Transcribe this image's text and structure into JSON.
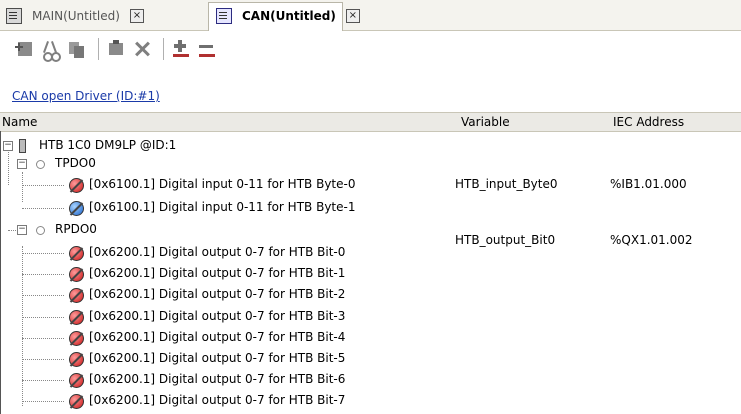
{
  "tabs": [
    {
      "label": "MAIN(Untitled)",
      "active": false,
      "icon": "program-icon",
      "close": "×"
    },
    {
      "label": "CAN(Untitled)",
      "active": true,
      "icon": "can-config-icon",
      "close": "×"
    }
  ],
  "toolbar": {
    "icons": [
      "add-device-icon",
      "cut-icon",
      "copy-icon",
      "paste-icon",
      "delete-icon",
      "add-all-icon",
      "remove-all-icon"
    ]
  },
  "driver_link": "CAN open Driver (ID:#1)",
  "columns": {
    "name": "Name",
    "variable": "Variable",
    "iec": "IEC Address"
  },
  "tree": {
    "device": {
      "label": "HTB 1C0 DM9LP @ID:1",
      "expander": "−"
    },
    "tpdo": {
      "label": "TPDO0",
      "expander": "−"
    },
    "tpdo_items": [
      {
        "label": "[0x6100.1] Digital input 0-11 for HTB Byte-0",
        "variable": "HTB_input_Byte0",
        "iec": "%IB1.01.000",
        "color": "red"
      },
      {
        "label": "[0x6100.1] Digital input 0-11 for HTB Byte-1",
        "variable": "",
        "iec": "",
        "color": "blue"
      }
    ],
    "rpdo": {
      "label": "RPDO0",
      "expander": "−"
    },
    "rpdo_items": [
      {
        "label": "[0x6200.1] Digital output 0-7 for HTB Bit-0",
        "variable": "HTB_output_Bit0",
        "iec": "%QX1.01.002",
        "color": "red"
      },
      {
        "label": "[0x6200.1] Digital output 0-7 for HTB Bit-1",
        "variable": "",
        "iec": "",
        "color": "red"
      },
      {
        "label": "[0x6200.1] Digital output 0-7 for HTB Bit-2",
        "variable": "",
        "iec": "",
        "color": "red"
      },
      {
        "label": "[0x6200.1] Digital output 0-7 for HTB Bit-3",
        "variable": "",
        "iec": "",
        "color": "red"
      },
      {
        "label": "[0x6200.1] Digital output 0-7 for HTB Bit-4",
        "variable": "",
        "iec": "",
        "color": "red"
      },
      {
        "label": "[0x6200.1] Digital output 0-7 for HTB Bit-5",
        "variable": "",
        "iec": "",
        "color": "red"
      },
      {
        "label": "[0x6200.1] Digital output 0-7 for HTB Bit-6",
        "variable": "",
        "iec": "",
        "color": "red"
      },
      {
        "label": "[0x6200.1] Digital output 0-7 for HTB Bit-7",
        "variable": "",
        "iec": "",
        "color": "red"
      }
    ]
  },
  "colors": {
    "link": "#1a3aa8",
    "pin_red": "#c71414",
    "pin_blue": "#1a62c9"
  }
}
